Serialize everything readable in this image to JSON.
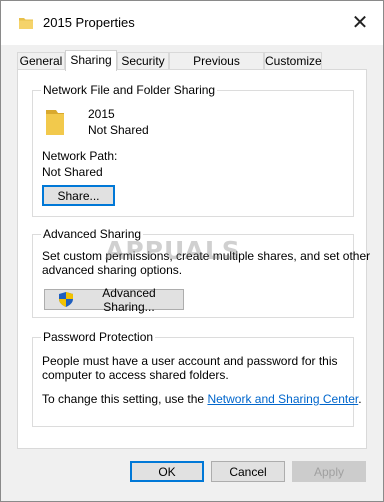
{
  "window": {
    "title": "2015 Properties",
    "close_glyph": "✕"
  },
  "tabs": [
    {
      "label": "General"
    },
    {
      "label": "Sharing",
      "active": true
    },
    {
      "label": "Security"
    },
    {
      "label": "Previous Versions"
    },
    {
      "label": "Customize"
    }
  ],
  "network_sharing": {
    "group_label": "Network File and Folder Sharing",
    "folder_name": "2015",
    "folder_status": "Not Shared",
    "path_label": "Network Path:",
    "path_value": "Not Shared",
    "share_button": "Share..."
  },
  "advanced_sharing": {
    "group_label": "Advanced Sharing",
    "description_line1": "Set custom permissions, create multiple shares, and set other",
    "description_line2": "advanced sharing options.",
    "button_label": "Advanced Sharing...",
    "button_icon": "uac-shield-icon"
  },
  "password_protection": {
    "group_label": "Password Protection",
    "line1": "People must have a user account and password for this",
    "line2": "computer to access shared folders.",
    "change_prefix": "To change this setting, use the ",
    "link_text": "Network and Sharing Center",
    "change_suffix": "."
  },
  "footer": {
    "ok": "OK",
    "cancel": "Cancel",
    "apply": "Apply"
  },
  "watermark": "APPUALS",
  "colors": {
    "folder": "#e8c04a",
    "link": "#0066cc",
    "focus": "#0078d7"
  }
}
